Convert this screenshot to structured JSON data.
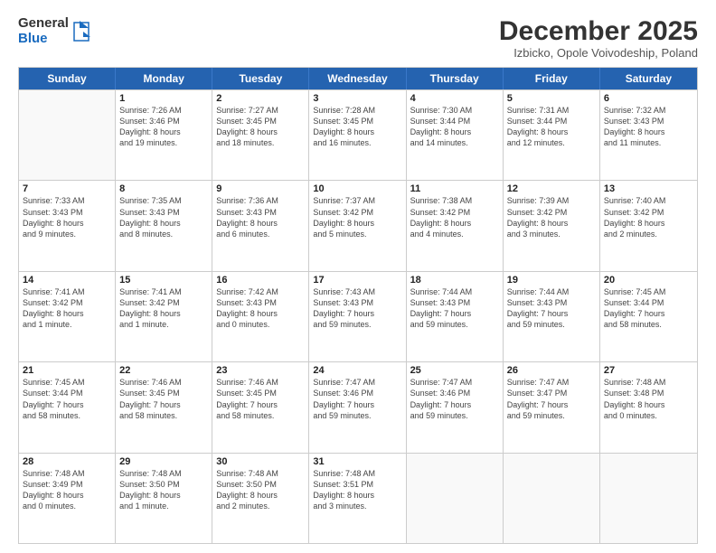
{
  "logo": {
    "general": "General",
    "blue": "Blue"
  },
  "header": {
    "month": "December 2025",
    "location": "Izbicko, Opole Voivodeship, Poland"
  },
  "days": [
    "Sunday",
    "Monday",
    "Tuesday",
    "Wednesday",
    "Thursday",
    "Friday",
    "Saturday"
  ],
  "weeks": [
    [
      {
        "day": "",
        "lines": []
      },
      {
        "day": "1",
        "lines": [
          "Sunrise: 7:26 AM",
          "Sunset: 3:46 PM",
          "Daylight: 8 hours",
          "and 19 minutes."
        ]
      },
      {
        "day": "2",
        "lines": [
          "Sunrise: 7:27 AM",
          "Sunset: 3:45 PM",
          "Daylight: 8 hours",
          "and 18 minutes."
        ]
      },
      {
        "day": "3",
        "lines": [
          "Sunrise: 7:28 AM",
          "Sunset: 3:45 PM",
          "Daylight: 8 hours",
          "and 16 minutes."
        ]
      },
      {
        "day": "4",
        "lines": [
          "Sunrise: 7:30 AM",
          "Sunset: 3:44 PM",
          "Daylight: 8 hours",
          "and 14 minutes."
        ]
      },
      {
        "day": "5",
        "lines": [
          "Sunrise: 7:31 AM",
          "Sunset: 3:44 PM",
          "Daylight: 8 hours",
          "and 12 minutes."
        ]
      },
      {
        "day": "6",
        "lines": [
          "Sunrise: 7:32 AM",
          "Sunset: 3:43 PM",
          "Daylight: 8 hours",
          "and 11 minutes."
        ]
      }
    ],
    [
      {
        "day": "7",
        "lines": [
          "Sunrise: 7:33 AM",
          "Sunset: 3:43 PM",
          "Daylight: 8 hours",
          "and 9 minutes."
        ]
      },
      {
        "day": "8",
        "lines": [
          "Sunrise: 7:35 AM",
          "Sunset: 3:43 PM",
          "Daylight: 8 hours",
          "and 8 minutes."
        ]
      },
      {
        "day": "9",
        "lines": [
          "Sunrise: 7:36 AM",
          "Sunset: 3:43 PM",
          "Daylight: 8 hours",
          "and 6 minutes."
        ]
      },
      {
        "day": "10",
        "lines": [
          "Sunrise: 7:37 AM",
          "Sunset: 3:42 PM",
          "Daylight: 8 hours",
          "and 5 minutes."
        ]
      },
      {
        "day": "11",
        "lines": [
          "Sunrise: 7:38 AM",
          "Sunset: 3:42 PM",
          "Daylight: 8 hours",
          "and 4 minutes."
        ]
      },
      {
        "day": "12",
        "lines": [
          "Sunrise: 7:39 AM",
          "Sunset: 3:42 PM",
          "Daylight: 8 hours",
          "and 3 minutes."
        ]
      },
      {
        "day": "13",
        "lines": [
          "Sunrise: 7:40 AM",
          "Sunset: 3:42 PM",
          "Daylight: 8 hours",
          "and 2 minutes."
        ]
      }
    ],
    [
      {
        "day": "14",
        "lines": [
          "Sunrise: 7:41 AM",
          "Sunset: 3:42 PM",
          "Daylight: 8 hours",
          "and 1 minute."
        ]
      },
      {
        "day": "15",
        "lines": [
          "Sunrise: 7:41 AM",
          "Sunset: 3:42 PM",
          "Daylight: 8 hours",
          "and 1 minute."
        ]
      },
      {
        "day": "16",
        "lines": [
          "Sunrise: 7:42 AM",
          "Sunset: 3:43 PM",
          "Daylight: 8 hours",
          "and 0 minutes."
        ]
      },
      {
        "day": "17",
        "lines": [
          "Sunrise: 7:43 AM",
          "Sunset: 3:43 PM",
          "Daylight: 7 hours",
          "and 59 minutes."
        ]
      },
      {
        "day": "18",
        "lines": [
          "Sunrise: 7:44 AM",
          "Sunset: 3:43 PM",
          "Daylight: 7 hours",
          "and 59 minutes."
        ]
      },
      {
        "day": "19",
        "lines": [
          "Sunrise: 7:44 AM",
          "Sunset: 3:43 PM",
          "Daylight: 7 hours",
          "and 59 minutes."
        ]
      },
      {
        "day": "20",
        "lines": [
          "Sunrise: 7:45 AM",
          "Sunset: 3:44 PM",
          "Daylight: 7 hours",
          "and 58 minutes."
        ]
      }
    ],
    [
      {
        "day": "21",
        "lines": [
          "Sunrise: 7:45 AM",
          "Sunset: 3:44 PM",
          "Daylight: 7 hours",
          "and 58 minutes."
        ]
      },
      {
        "day": "22",
        "lines": [
          "Sunrise: 7:46 AM",
          "Sunset: 3:45 PM",
          "Daylight: 7 hours",
          "and 58 minutes."
        ]
      },
      {
        "day": "23",
        "lines": [
          "Sunrise: 7:46 AM",
          "Sunset: 3:45 PM",
          "Daylight: 7 hours",
          "and 58 minutes."
        ]
      },
      {
        "day": "24",
        "lines": [
          "Sunrise: 7:47 AM",
          "Sunset: 3:46 PM",
          "Daylight: 7 hours",
          "and 59 minutes."
        ]
      },
      {
        "day": "25",
        "lines": [
          "Sunrise: 7:47 AM",
          "Sunset: 3:46 PM",
          "Daylight: 7 hours",
          "and 59 minutes."
        ]
      },
      {
        "day": "26",
        "lines": [
          "Sunrise: 7:47 AM",
          "Sunset: 3:47 PM",
          "Daylight: 7 hours",
          "and 59 minutes."
        ]
      },
      {
        "day": "27",
        "lines": [
          "Sunrise: 7:48 AM",
          "Sunset: 3:48 PM",
          "Daylight: 8 hours",
          "and 0 minutes."
        ]
      }
    ],
    [
      {
        "day": "28",
        "lines": [
          "Sunrise: 7:48 AM",
          "Sunset: 3:49 PM",
          "Daylight: 8 hours",
          "and 0 minutes."
        ]
      },
      {
        "day": "29",
        "lines": [
          "Sunrise: 7:48 AM",
          "Sunset: 3:50 PM",
          "Daylight: 8 hours",
          "and 1 minute."
        ]
      },
      {
        "day": "30",
        "lines": [
          "Sunrise: 7:48 AM",
          "Sunset: 3:50 PM",
          "Daylight: 8 hours",
          "and 2 minutes."
        ]
      },
      {
        "day": "31",
        "lines": [
          "Sunrise: 7:48 AM",
          "Sunset: 3:51 PM",
          "Daylight: 8 hours",
          "and 3 minutes."
        ]
      },
      {
        "day": "",
        "lines": []
      },
      {
        "day": "",
        "lines": []
      },
      {
        "day": "",
        "lines": []
      }
    ]
  ]
}
